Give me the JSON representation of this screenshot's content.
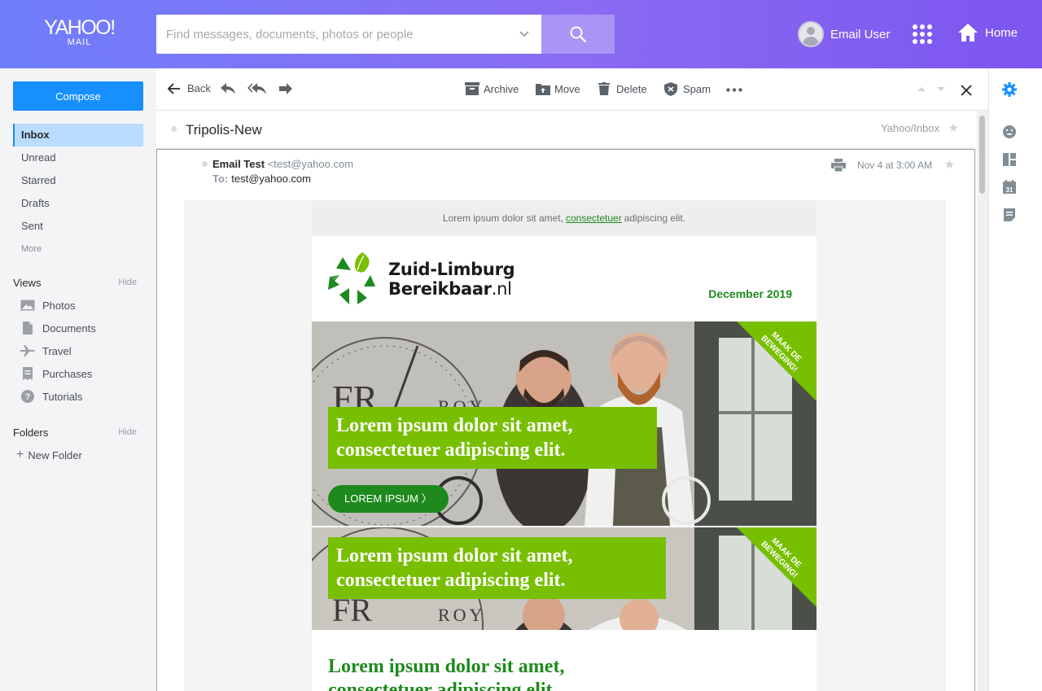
{
  "brand": {
    "name": "YAHOO!",
    "product": "MAIL"
  },
  "search": {
    "placeholder": "Find messages, documents, photos or people"
  },
  "header": {
    "user_name": "Email User",
    "home_label": "Home"
  },
  "sidebar": {
    "compose_label": "Compose",
    "folders": [
      {
        "label": "Inbox",
        "active": true
      },
      {
        "label": "Unread"
      },
      {
        "label": "Starred"
      },
      {
        "label": "Drafts"
      },
      {
        "label": "Sent"
      },
      {
        "label": "More"
      }
    ],
    "views_title": "Views",
    "views_hide": "Hide",
    "views": [
      {
        "label": "Photos",
        "icon": "photo-icon"
      },
      {
        "label": "Documents",
        "icon": "document-icon"
      },
      {
        "label": "Travel",
        "icon": "plane-icon"
      },
      {
        "label": "Purchases",
        "icon": "receipt-icon"
      },
      {
        "label": "Tutorials",
        "icon": "help-icon"
      }
    ],
    "folders_title": "Folders",
    "folders_hide": "Hide",
    "new_folder": "New Folder"
  },
  "toolbar": {
    "back": "Back",
    "archive": "Archive",
    "move": "Move",
    "delete": "Delete",
    "spam": "Spam"
  },
  "message": {
    "subject": "Tripolis-New",
    "folder_path": "Yahoo/Inbox",
    "from_name": "Email Test",
    "from_address": "<test@yahoo.com",
    "to_label": "To:",
    "to_address": "test@yahoo.com",
    "date": "Nov 4 at 3:00 AM"
  },
  "email": {
    "preheader_before": "Lorem ipsum dolor sit amet,",
    "preheader_link": "consectetuer",
    "preheader_after": "adipiscing elit.",
    "brand_line1": "Zuid-Limburg",
    "brand_line2": "Bereikbaar",
    "brand_tld": ".nl",
    "month": "December 2019",
    "corner_text": "MAAK DE BEWEGING!",
    "hero1_line1": "Lorem ipsum dolor sit amet,",
    "hero1_line2": "consectetuer adipiscing elit.",
    "cta_label": "LOREM IPSUM 〉",
    "hero2_line1": "Lorem ipsum dolor sit amet,",
    "hero2_line2": "consectetuer adipiscing elit.",
    "heading_line1": "Lorem ipsum dolor sit amet,",
    "heading_line2": "consectetuer adipiscing elit."
  },
  "colors": {
    "header_gradient_start": "#6f7efb",
    "header_gradient_end": "#7d55f0",
    "compose": "#188fff",
    "active_folder": "#b9dcff",
    "email_green": "#77bf00",
    "email_dark_green": "#1e8a1e"
  }
}
